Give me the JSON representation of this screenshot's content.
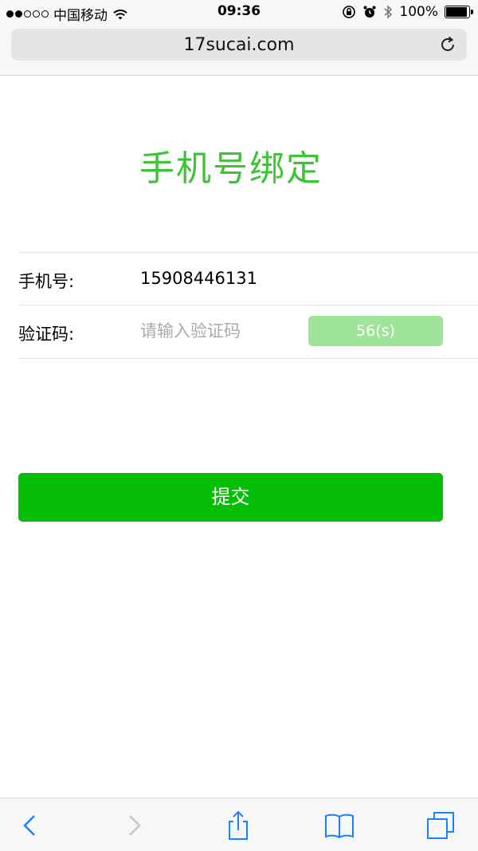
{
  "status_bar": {
    "carrier": "中国移动",
    "time": "09:36",
    "battery": "100%",
    "signal_dots_filled": 2,
    "signal_dots_total": 5
  },
  "browser": {
    "url": "17sucai.com"
  },
  "page": {
    "title": "手机号绑定",
    "phone_label": "手机号:",
    "phone_value": "15908446131",
    "code_label": "验证码:",
    "code_placeholder": "请输入验证码",
    "code_value": "",
    "countdown": "56(s)",
    "submit_label": "提交"
  },
  "colors": {
    "title_green": "#3cc435",
    "submit_green": "#06be06",
    "countdown_green": "#9ee59a",
    "ios_blue": "#1a82fb"
  },
  "toolbar": {
    "icons": [
      "back-icon",
      "forward-icon",
      "share-icon",
      "bookmarks-icon",
      "tabs-icon"
    ]
  }
}
